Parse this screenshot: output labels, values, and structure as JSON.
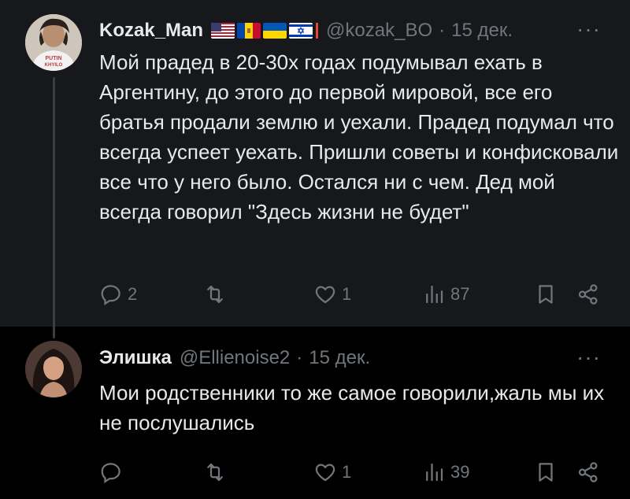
{
  "tweets": [
    {
      "author_name": "Kozak_Man",
      "handle": "@kozak_BO",
      "separator": "·",
      "date": "15 дек.",
      "more": "···",
      "flags": [
        "us-flag",
        "moldova-flag",
        "ukraine-flag",
        "israel-flag"
      ],
      "avatar_shirt_text": "PUTIN KHYILO",
      "text": "Мой прадед в 20-30х годах подумывал ехать в Аргентину, до этого до первой мировой, все его братья продали землю и уехали. Прадед подумал что всегда успеет уехать. Пришли советы и конфисковали все что у него было. Остался ни с чем. Дед мой всегда говорил \"Здесь жизни не будет\"",
      "reply_count": "2",
      "retweet_count": "",
      "like_count": "1",
      "view_count": "87"
    },
    {
      "author_name": "Элишка",
      "handle": "@Ellienoise2",
      "separator": "·",
      "date": "15 дек.",
      "more": "···",
      "text": "Мои родственники то же самое говорили,жаль мы их не послушались",
      "reply_count": "",
      "retweet_count": "",
      "like_count": "1",
      "view_count": "39"
    }
  ],
  "icons": [
    "reply-icon",
    "retweet-icon",
    "like-icon",
    "views-icon",
    "bookmark-icon",
    "share-icon"
  ],
  "colors": {
    "background": "#000000",
    "highlight_background": "#16181c",
    "text_primary": "#e7e9ea",
    "text_secondary": "#71767b",
    "thread_line": "#3a3d41"
  }
}
